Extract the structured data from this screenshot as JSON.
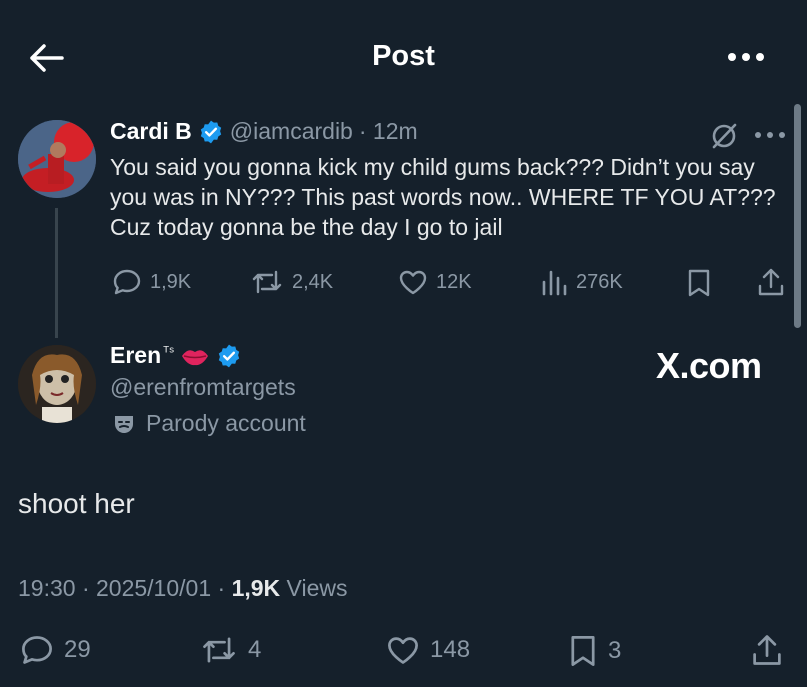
{
  "header": {
    "title": "Post"
  },
  "quoted": {
    "name": "Cardi B",
    "handle": "@iamcardib",
    "time": "· 12m",
    "text": "You said you gonna kick my child gums back???  Didn’t you say you was in NY??? This past words now.. WHERE TF YOU AT??? Cuz today gonna be the day I go to jail",
    "metrics": {
      "replies": "1,9K",
      "reposts": "2,4K",
      "likes": "12K",
      "views": "276K"
    }
  },
  "post": {
    "name": "Eren",
    "name_sup": "ᵀˢ",
    "handle": "@erenfromtargets",
    "label": "Parody account",
    "watermark": "X.com",
    "text": "shoot her",
    "time": "19:30 · 2025/10/01 · ",
    "views_count": "1,9K",
    "views_label": " Views",
    "actions": {
      "replies": "29",
      "reposts": "4",
      "likes": "148",
      "bookmarks": "3"
    }
  },
  "colors": {
    "background": "#15202b",
    "verified": "#1d9bf0",
    "muted": "#8b98a5"
  },
  "icons": [
    "back-arrow-icon",
    "more-icon",
    "verified-badge-icon",
    "grok-icon",
    "reply-icon",
    "repost-icon",
    "like-icon",
    "views-icon",
    "bookmark-icon",
    "share-icon",
    "lips-icon",
    "parody-mask-icon"
  ]
}
